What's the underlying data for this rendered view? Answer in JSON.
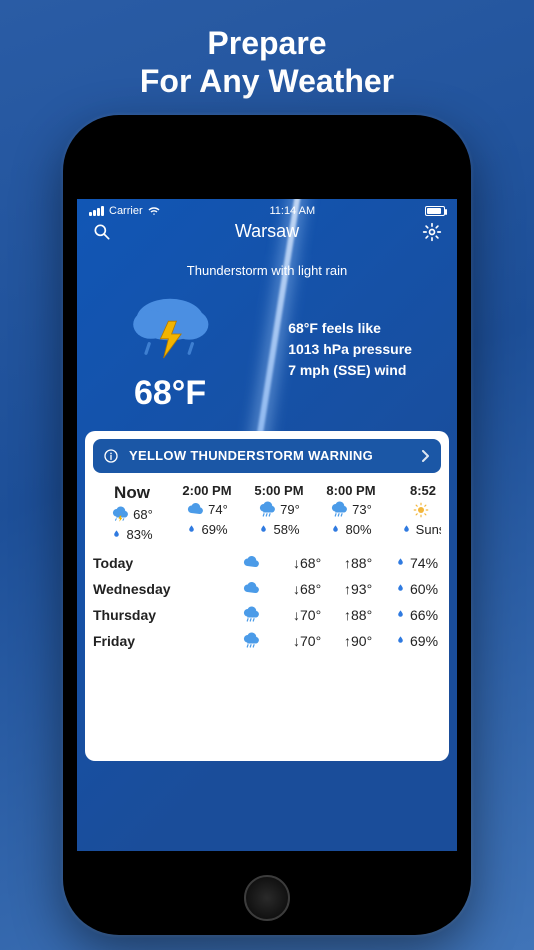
{
  "promo": {
    "line1": "Prepare",
    "line2": "For Any Weather"
  },
  "status": {
    "time": "11:14 AM",
    "carrier": "Carrier"
  },
  "nav": {
    "title": "Warsaw"
  },
  "condition": "Thunderstorm with light rain",
  "hero": {
    "temp": "68°F",
    "feels": "68°F feels like",
    "pressure": "1013 hPa pressure",
    "wind": "7 mph (SSE) wind"
  },
  "alert": {
    "text": "YELLOW THUNDERSTORM WARNING"
  },
  "hourly_labels": {
    "now": "Now"
  },
  "hourly": [
    {
      "time": "Now",
      "icon": "storm",
      "temp": "68°",
      "hum": "83%"
    },
    {
      "time": "2:00 PM",
      "icon": "cloud",
      "temp": "74°",
      "hum": "69%"
    },
    {
      "time": "5:00 PM",
      "icon": "rain",
      "temp": "79°",
      "hum": "58%"
    },
    {
      "time": "8:00 PM",
      "icon": "rain",
      "temp": "73°",
      "hum": "80%"
    },
    {
      "time": "8:52",
      "icon": "sun",
      "temp": "",
      "hum": "Suns"
    }
  ],
  "daily": [
    {
      "name": "Today",
      "icon": "cloud",
      "low": "↓68°",
      "high": "↑88°",
      "hum": "74%"
    },
    {
      "name": "Wednesday",
      "icon": "cloud",
      "low": "↓68°",
      "high": "↑93°",
      "hum": "60%"
    },
    {
      "name": "Thursday",
      "icon": "rain",
      "low": "↓70°",
      "high": "↑88°",
      "hum": "66%"
    },
    {
      "name": "Friday",
      "icon": "rain",
      "low": "↓70°",
      "high": "↑90°",
      "hum": "69%"
    }
  ]
}
